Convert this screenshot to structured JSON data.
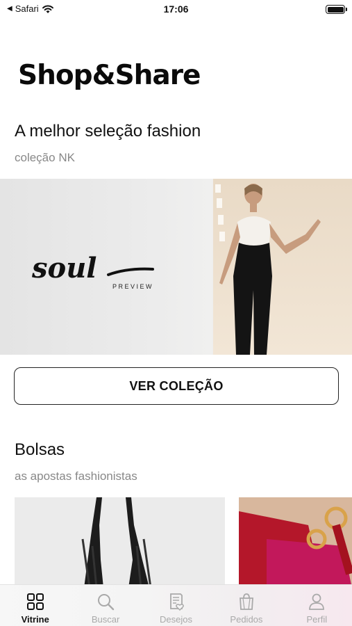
{
  "status_bar": {
    "back_label": "Safari",
    "time": "17:06"
  },
  "brand": "Shop&Share",
  "featured": {
    "title": "A melhor seleção fashion",
    "subtitle": "coleção NK",
    "banner_logo": "soul",
    "banner_tag": "PREVIEW",
    "cta_label": "VER COLEÇÃO"
  },
  "bags": {
    "title": "Bolsas",
    "subtitle": "as apostas fashionistas"
  },
  "tab_bar": {
    "tabs": [
      {
        "label": "Vitrine",
        "icon": "grid-icon",
        "active": true
      },
      {
        "label": "Buscar",
        "icon": "search-icon",
        "active": false
      },
      {
        "label": "Desejos",
        "icon": "wishlist-icon",
        "active": false
      },
      {
        "label": "Pedidos",
        "icon": "shopping-bag-icon",
        "active": false
      },
      {
        "label": "Perfil",
        "icon": "user-icon",
        "active": false
      }
    ]
  },
  "colors": {
    "text": "#111111",
    "muted": "#888888",
    "inactive_tab": "#a9a9a9"
  }
}
